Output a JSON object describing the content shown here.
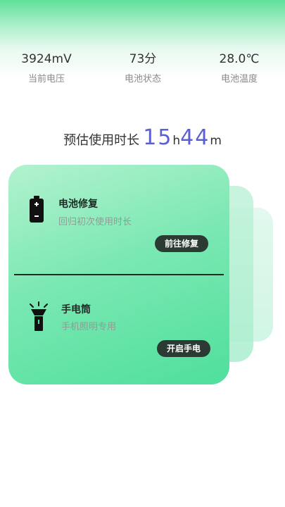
{
  "stats": [
    {
      "value": "3924mV",
      "label": "当前电压"
    },
    {
      "value": "73分",
      "label": "电池状态"
    },
    {
      "value": "28.0℃",
      "label": "电池温度"
    }
  ],
  "estimate": {
    "prefix": "预估使用时长",
    "hours": "15",
    "hours_unit": "h",
    "minutes": "44",
    "minutes_unit": "m"
  },
  "features": {
    "battery_repair": {
      "icon": "battery-icon",
      "title": "电池修复",
      "subtitle": "回归初次使用时长",
      "button": "前往修复"
    },
    "flashlight": {
      "icon": "flashlight-icon",
      "title": "手电筒",
      "subtitle": "手机照明专用",
      "button": "开启手电"
    }
  },
  "colors": {
    "accent": "#5b5fd6",
    "card_green": "#4fdf9c",
    "button_dark": "#2b3a33"
  }
}
